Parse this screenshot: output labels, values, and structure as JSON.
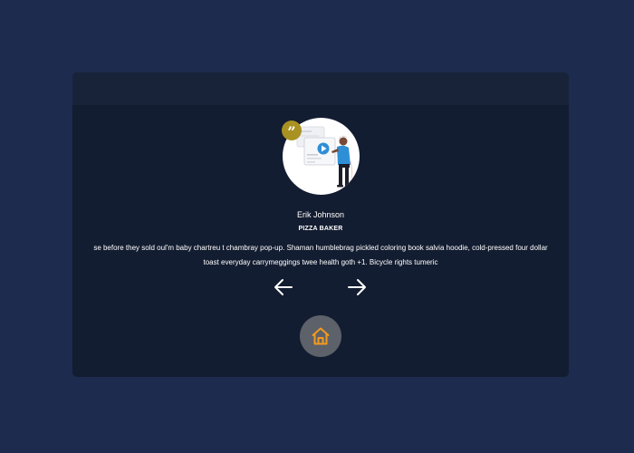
{
  "testimonial": {
    "name": "Erik Johnson",
    "role": "PIZZA BAKER",
    "text": "se before they sold oul'm baby chartreu t chambray pop-up. Shaman humblebrag pickled coloring book salvia hoodie, cold-pressed four dollar toast everyday carrymeggings twee health goth +1. Bicycle rights tumeric",
    "avatar_icon": "person-presenting-video-illustration",
    "quote_icon": "quote-icon"
  },
  "navigation": {
    "prev_icon": "arrow-left-icon",
    "next_icon": "arrow-right-icon",
    "home_icon": "home-icon"
  },
  "colors": {
    "page_background": "#1c2b4e",
    "card_background": "#131d31",
    "card_header": "#182339",
    "quote_badge": "#a99221",
    "home_button": "#5d6169",
    "home_icon": "#f29a1f",
    "illustration_accent": "#2f8fd6"
  }
}
